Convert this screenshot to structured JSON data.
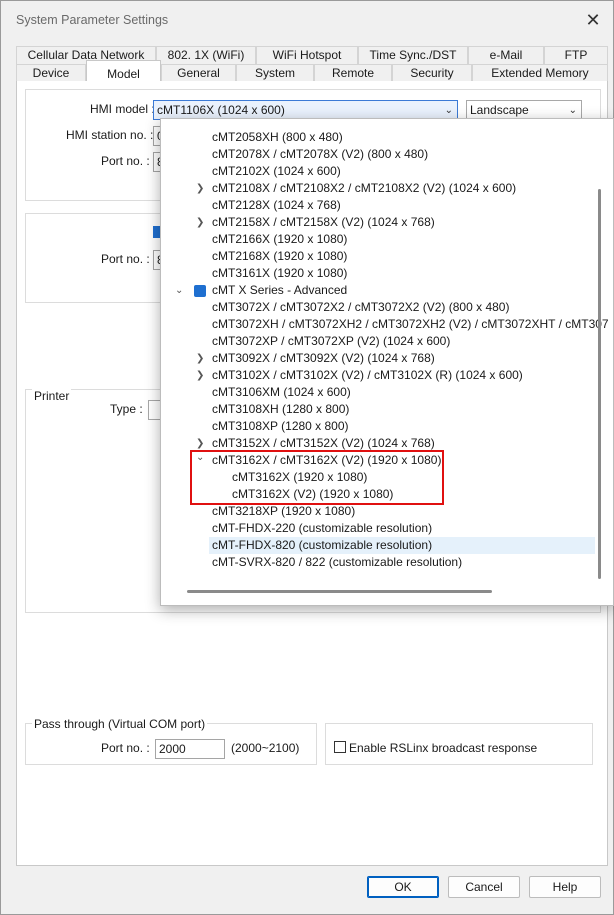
{
  "window": {
    "title": "System Parameter Settings"
  },
  "tabs_row1": [
    "Cellular Data Network",
    "802. 1X (WiFi)",
    "WiFi Hotspot",
    "Time Sync./DST",
    "e-Mail",
    "FTP"
  ],
  "tabs_row2": [
    "Device",
    "Model",
    "General",
    "System",
    "Remote",
    "Security",
    "Extended Memory"
  ],
  "model": {
    "hmi_model_label": "HMI model :",
    "hmi_model_value": "cMT1106X (1024 x 600)",
    "orientation_value": "Landscape",
    "station_label": "HMI station no. :",
    "station_value": "0",
    "port_label": "Port no. :",
    "port_value": "8",
    "port2_label": "Port no. :",
    "port2_value": "8"
  },
  "printer": {
    "group_label": "Printer",
    "type_label": "Type :"
  },
  "passthrough": {
    "group_label": "Pass through (Virtual COM port)",
    "port_label": "Port no. :",
    "port_value": "2000",
    "range": "(2000~2100)",
    "rslinx_label": "Enable RSLinx broadcast response"
  },
  "dropdown_items": [
    "cMT2058XH (800 x 480)",
    "cMT2078X / cMT2078X (V2) (800 x 480)",
    "cMT2102X (1024 x 600)",
    "cMT2108X / cMT2108X2 / cMT2108X2 (V2) (1024 x 600)",
    "cMT2128X (1024 x 768)",
    "cMT2158X / cMT2158X (V2) (1024 x 768)",
    "cMT2166X (1920 x 1080)",
    "cMT2168X (1920 x 1080)",
    "cMT3161X (1920 x 1080)",
    "cMT X Series - Advanced",
    "cMT3072X / cMT3072X2 / cMT3072X2 (V2) (800 x 480)",
    "cMT3072XH / cMT3072XH2 / cMT3072XH2 (V2) / cMT3072XHT / cMT307",
    "cMT3072XP / cMT3072XP (V2) (1024 x 600)",
    "cMT3092X / cMT3092X (V2) (1024 x 768)",
    "cMT3102X / cMT3102X (V2) / cMT3102X (R) (1024 x 600)",
    "cMT3106XM (1024 x 600)",
    "cMT3108XH (1280 x 800)",
    "cMT3108XP (1280 x 800)",
    "cMT3152X / cMT3152X (V2) (1024 x 768)",
    "cMT3162X / cMT3162X (V2) (1920 x 1080)",
    "cMT3162X (1920 x 1080)",
    "cMT3162X (V2) (1920 x 1080)",
    "cMT3218XP (1920 x 1080)",
    "cMT-FHDX-220 (customizable resolution)",
    "cMT-FHDX-820 (customizable resolution)",
    "cMT-SVRX-820 / 822 (customizable resolution)"
  ],
  "buttons": {
    "ok": "OK",
    "cancel": "Cancel",
    "help": "Help"
  }
}
